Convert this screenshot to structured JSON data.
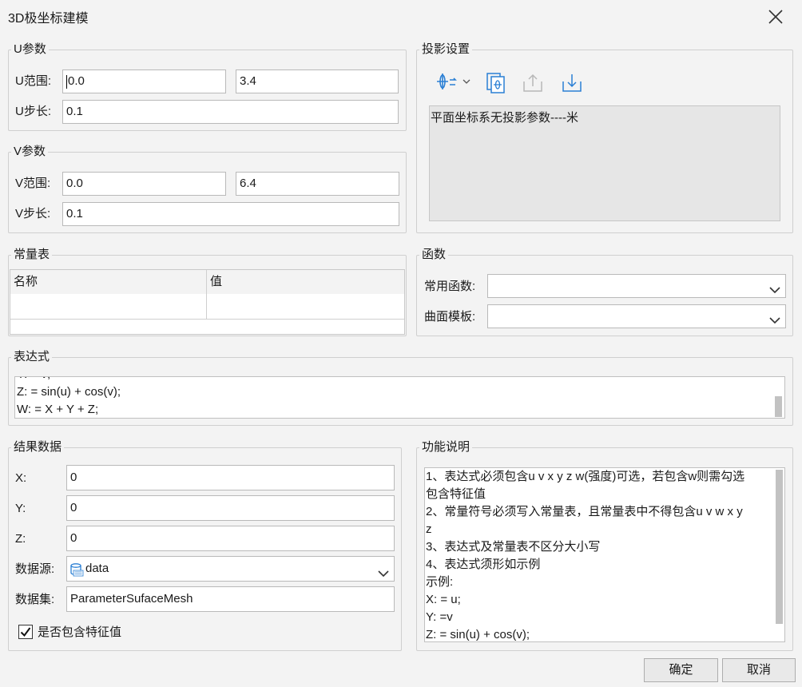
{
  "window": {
    "title": "3D极坐标建模"
  },
  "u_params": {
    "legend": "U参数",
    "range_label": "U范围:",
    "range_from": "0.0",
    "range_to": "3.4",
    "step_label": "U步长:",
    "step": "0.1"
  },
  "v_params": {
    "legend": "V参数",
    "range_label": "V范围:",
    "range_from": "0.0",
    "range_to": "6.4",
    "step_label": "V步长:",
    "step": "0.1"
  },
  "projection": {
    "legend": "投影设置",
    "info": "平面坐标系无投影参数----米"
  },
  "constants": {
    "legend": "常量表",
    "columns": [
      "名称",
      "值"
    ]
  },
  "functions": {
    "legend": "函数",
    "common_label": "常用函数:",
    "common_value": "",
    "template_label": "曲面模板:",
    "template_value": ""
  },
  "expression": {
    "legend": "表达式",
    "lines": [
      "Y: = v;",
      "Z: = sin(u) + cos(v);",
      "W: = X + Y + Z;"
    ]
  },
  "result": {
    "legend": "结果数据",
    "x_label": "X:",
    "x_value": "0",
    "y_label": "Y:",
    "y_value": "0",
    "z_label": "Z:",
    "z_value": "0",
    "datasource_label": "数据源:",
    "datasource_value": "data",
    "dataset_label": "数据集:",
    "dataset_value": "ParameterSufaceMesh",
    "feature_label": "是否包含特征值",
    "feature_checked": true
  },
  "help": {
    "legend": "功能说明",
    "lines": [
      "1、表达式必须包含u v x y z w(强度)可选，若包含w则需勾选",
      "包含特征值",
      "2、常量符号必须写入常量表，且常量表中不得包含u v w x y",
      "z",
      "3、表达式及常量表不区分大小写",
      "4、表达式须形如示例",
      "示例:",
      "X: = u;",
      "Y: =v",
      "Z: = sin(u) + cos(v);"
    ]
  },
  "buttons": {
    "ok": "确定",
    "cancel": "取消"
  },
  "colors": {
    "icon_blue": "#2a7fd4",
    "icon_disabled": "#b8b8b8"
  }
}
